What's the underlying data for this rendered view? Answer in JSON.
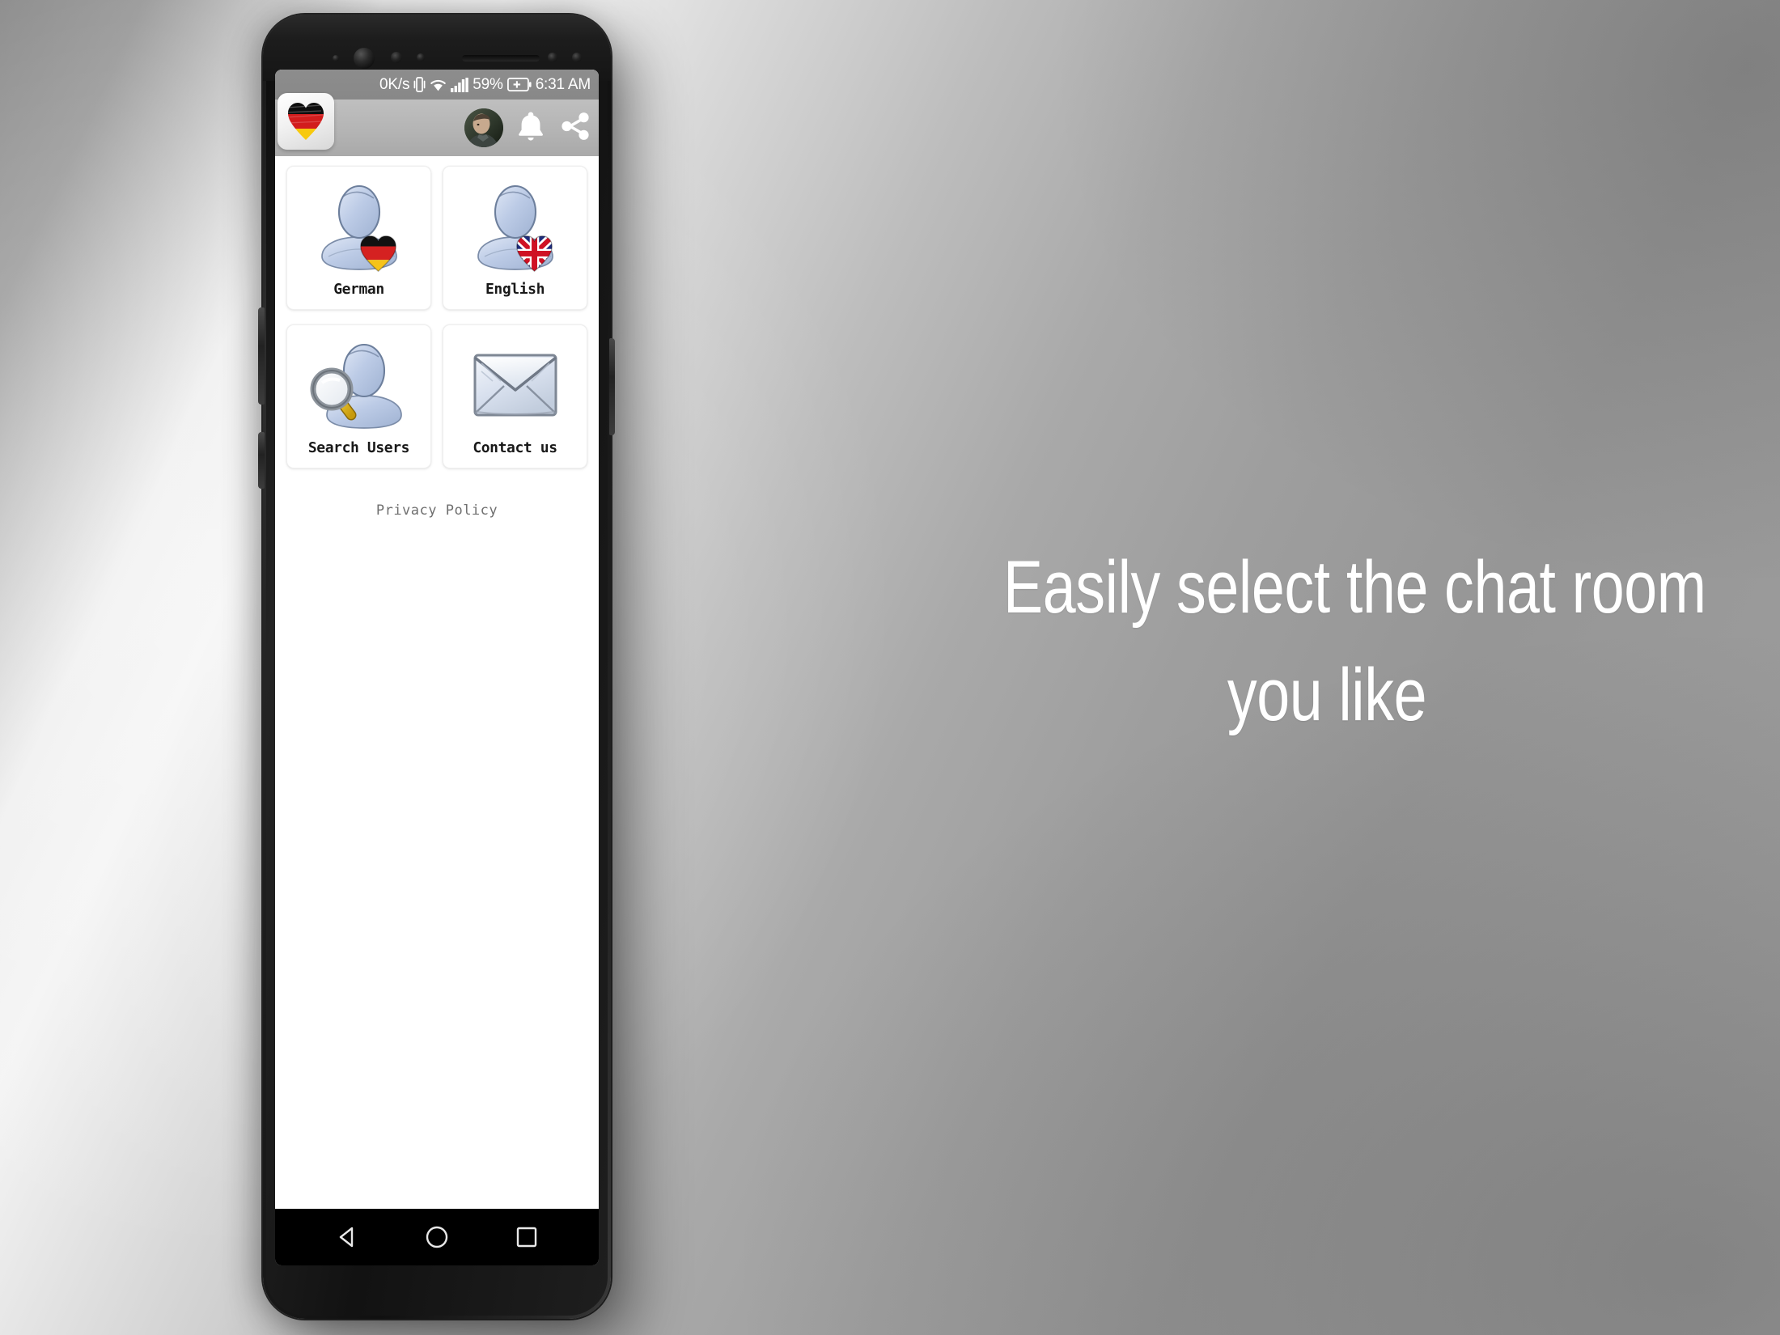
{
  "background": {
    "base_color": "#9a9a9a",
    "highlight_color": "#f4f4f4"
  },
  "phone": {
    "frame_color": "#1b1b1b",
    "hardware": {
      "earpiece": "earpiece-slot",
      "sensors": [
        "proximity-sensor",
        "front-camera",
        "light-sensor",
        "ir-sensor",
        "sensor-right-1",
        "sensor-right-2"
      ]
    }
  },
  "status_bar": {
    "network_speed": "0K/s",
    "vibrate_icon": "vibrate-icon",
    "wifi_icon": "wifi-icon",
    "signal_icon": "signal-bars-icon",
    "battery_percent": "59%",
    "battery_icon": "battery-charging-icon",
    "time": "6:31 AM",
    "background_color": "#8a8a8a",
    "text_color": "#ffffff"
  },
  "app_bar": {
    "logo_icon": "german-flag-heart-logo",
    "avatar_icon": "user-avatar",
    "notifications_icon": "bell-icon",
    "share_icon": "share-icon",
    "background_color": "#b4b4b4"
  },
  "main": {
    "grid": [
      {
        "id": "german",
        "label": "German",
        "icon": "user-german-flag-heart-icon"
      },
      {
        "id": "english",
        "label": "English",
        "icon": "user-uk-flag-heart-icon"
      },
      {
        "id": "search-users",
        "label": "Search Users",
        "icon": "user-magnifier-icon"
      },
      {
        "id": "contact-us",
        "label": "Contact us",
        "icon": "envelope-icon"
      }
    ],
    "privacy_policy": "Privacy Policy"
  },
  "nav_bar": {
    "back": "back-triangle-icon",
    "home": "home-circle-icon",
    "recents": "recents-square-icon",
    "background_color": "#000000"
  },
  "caption": {
    "line1": "Easily select the chat room",
    "line2": "you like",
    "color": "#ffffff"
  }
}
